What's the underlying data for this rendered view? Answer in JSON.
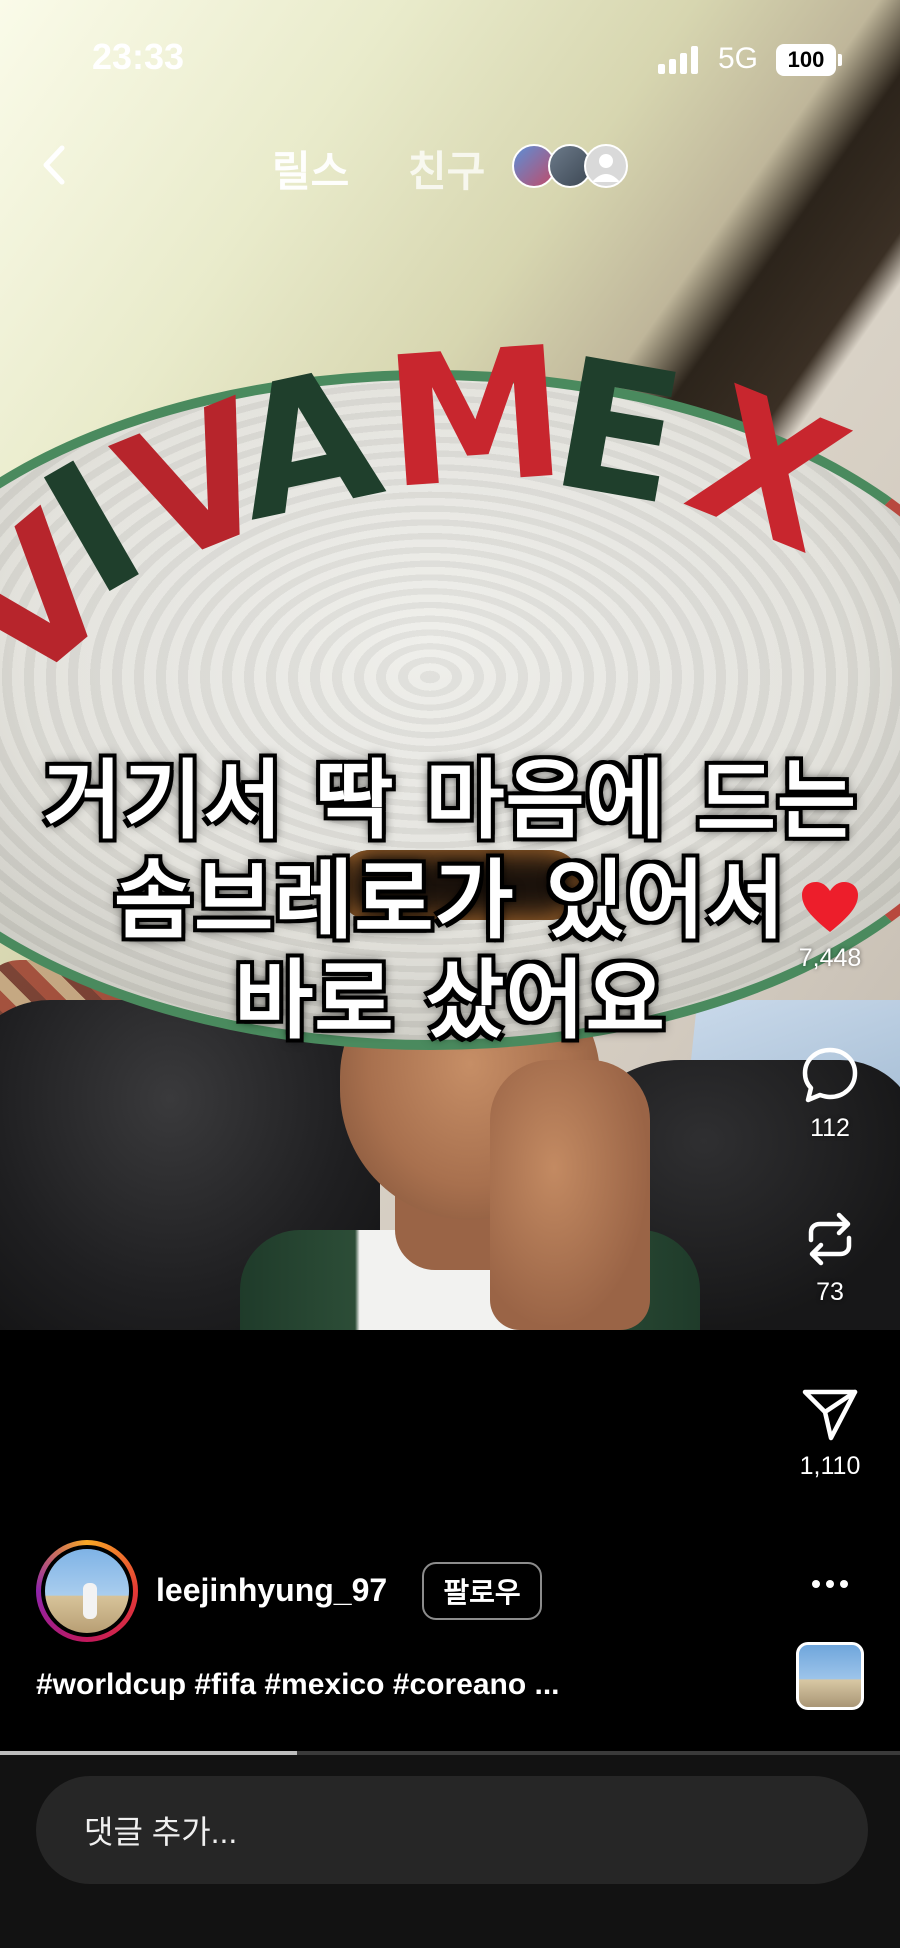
{
  "status_bar": {
    "time": "23:33",
    "network": "5G",
    "battery": "100"
  },
  "top_nav": {
    "tab_reels": "릴스",
    "tab_friends": "친구"
  },
  "video": {
    "caption_lines": [
      "거기서 딱 마음에 드는",
      "솜브레로가 있어서",
      "바로 샀어요"
    ],
    "hat_print": "VIVA MEX"
  },
  "actions": {
    "likes": "7,448",
    "comments": "112",
    "reposts": "73",
    "shares": "1,110",
    "like_color": "#ed1e2b"
  },
  "author": {
    "username": "leejinhyung_97",
    "follow_label": "팔로우"
  },
  "post": {
    "hashtags": "#worldcup #fifa #mexico #coreano ..."
  },
  "progress": {
    "played_fraction": 0.33
  },
  "comment": {
    "placeholder": "댓글 추가..."
  },
  "icons": [
    "chevron-left-icon",
    "heart-icon",
    "comment-icon",
    "repost-icon",
    "send-icon",
    "more-icon"
  ]
}
